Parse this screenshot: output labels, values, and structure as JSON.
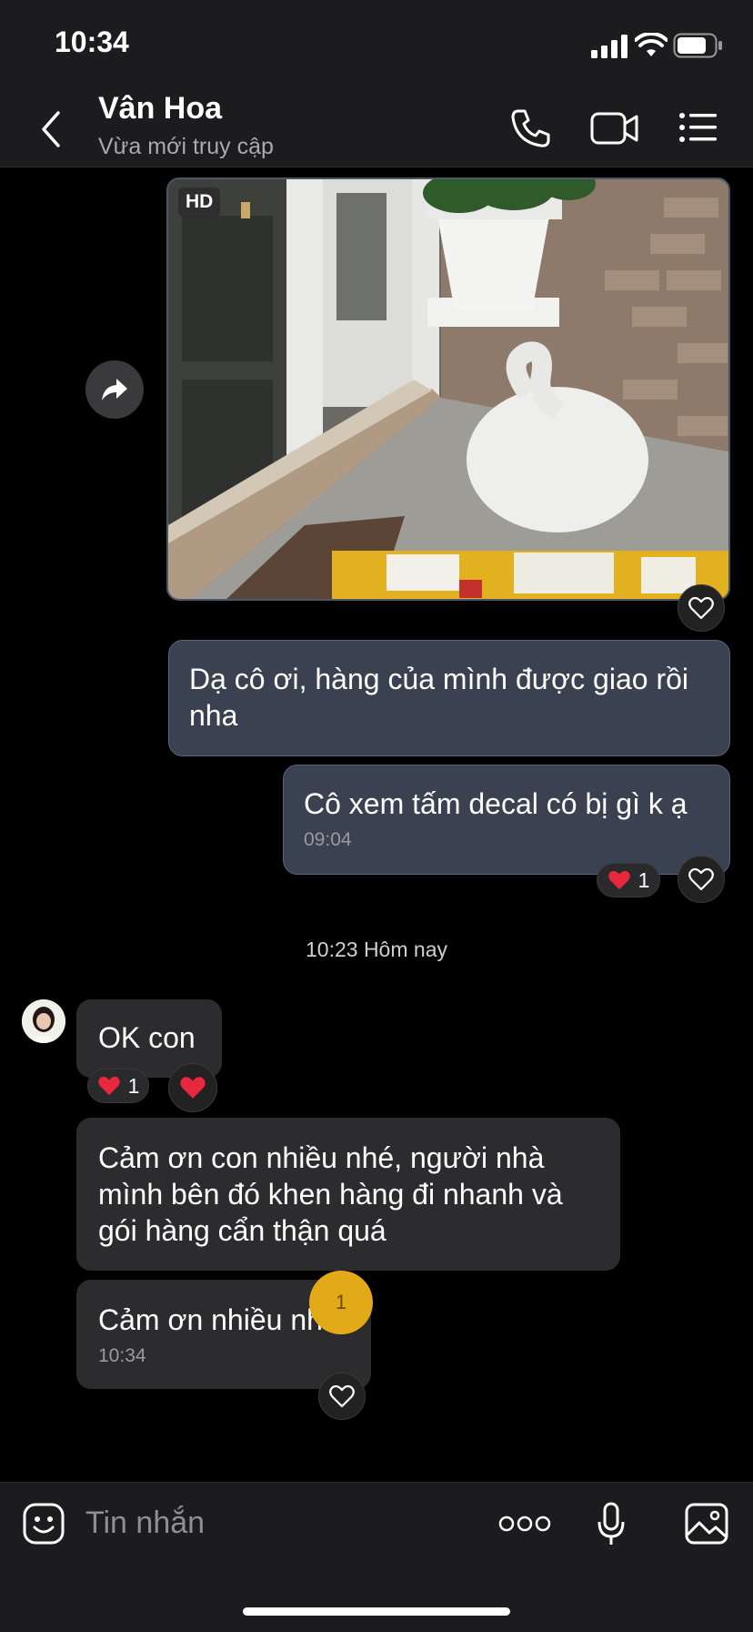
{
  "status_bar": {
    "time": "10:34"
  },
  "header": {
    "contact_name": "Vân Hoa",
    "contact_status": "Vừa mới truy cập"
  },
  "messages": {
    "photo": {
      "badge": "HD"
    },
    "out_1": {
      "text": "Dạ cô ơi, hàng của mình được giao rồi nha"
    },
    "out_2": {
      "text": "Cô xem tấm decal có bị gì k ạ",
      "time": "09:04",
      "reaction_count": "1"
    },
    "day_separator": "10:23 Hôm nay",
    "in_1": {
      "text": "OK con",
      "reaction_count": "1"
    },
    "in_2": {
      "text": "Cảm ơn con nhiều nhé, người nhà mình bên đó khen hàng đi nhanh và gói hàng cẩn thận quá"
    },
    "in_3": {
      "text": "Cảm ơn nhiều nhé",
      "time": "10:34",
      "badge": "1"
    }
  },
  "composer": {
    "placeholder": "Tin nhắn"
  },
  "colors": {
    "background": "#000000",
    "bar": "#1c1c1e",
    "outgoing_bubble": "#3a4150",
    "incoming_bubble": "#2c2c2e",
    "heart": "#e8283c",
    "badge": "#e3a918"
  },
  "icons": [
    "back-icon",
    "phone-icon",
    "video-icon",
    "list-icon",
    "forward-icon",
    "heart-outline-icon",
    "heart-icon",
    "sticker-icon",
    "more-icon",
    "mic-icon",
    "gallery-icon"
  ]
}
